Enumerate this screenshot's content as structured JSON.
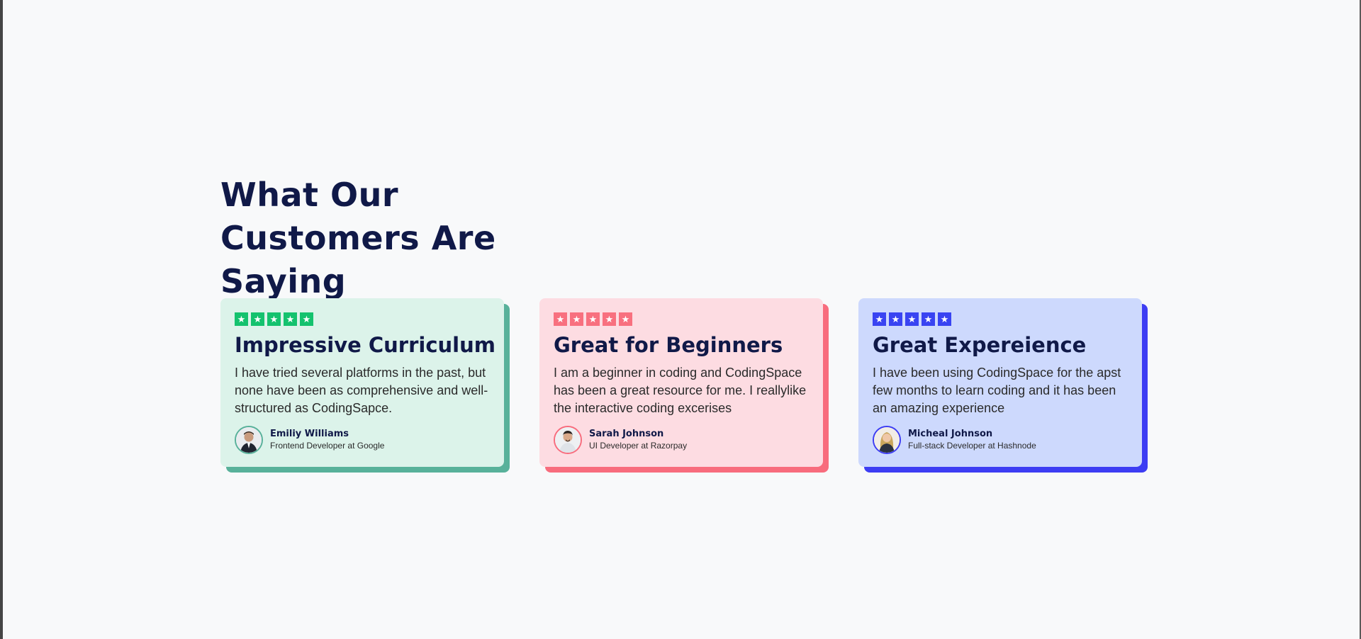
{
  "heading": "What Our Customers Are Saying",
  "cards": [
    {
      "title": "Impressive Curriculum",
      "text": "I have tried several platforms in the past, but none have been as comprehensive and well-structured as CodingSapce.",
      "author_name": "Emiliy Williams",
      "author_role": "Frontend Developer at Google",
      "rating": 5,
      "colors": {
        "background": "#dcf3ea",
        "accent": "#14c26e",
        "shadow": "#58b19a"
      }
    },
    {
      "title": "Great for Beginners",
      "text": "I am a beginner in coding and CodingSpace has been a great resource for me. I reallylike the interactive coding excerises",
      "author_name": "Sarah Johnson",
      "author_role": "UI Developer at Razorpay",
      "rating": 5,
      "colors": {
        "background": "#fddce2",
        "accent": "#f8707f",
        "shadow": "#f86c7d"
      }
    },
    {
      "title": "Great Expereience",
      "text": "I have been using CodingSpace for the apst few months to learn coding and it has been an amazing experience",
      "author_name": "Micheal Johnson",
      "author_role": "Full-stack Developer at Hashnode",
      "rating": 5,
      "colors": {
        "background": "#cdd9fd",
        "accent": "#3944f2",
        "shadow": "#3d3df3"
      }
    }
  ],
  "icons": {
    "star": "star-icon",
    "avatar": "person-avatar"
  }
}
